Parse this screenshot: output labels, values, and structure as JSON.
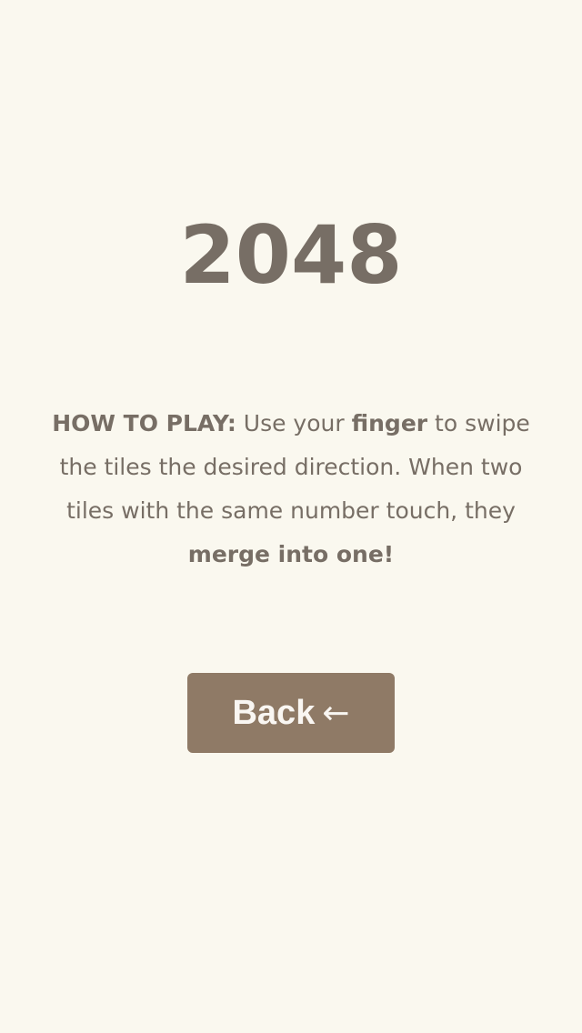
{
  "title": "2048",
  "instructions": {
    "heading": "HOW TO PLAY:",
    "text_1": " Use your ",
    "finger": "finger",
    "text_2": " to swipe the tiles the desired direction. When two tiles with the same number touch, they ",
    "merge": "merge into one!"
  },
  "back_button": {
    "label": "Back",
    "arrow": "←"
  },
  "colors": {
    "background": "#faf8ef",
    "text": "#776e65",
    "button": "#8f7a66",
    "button_text": "#f9f6f2"
  }
}
